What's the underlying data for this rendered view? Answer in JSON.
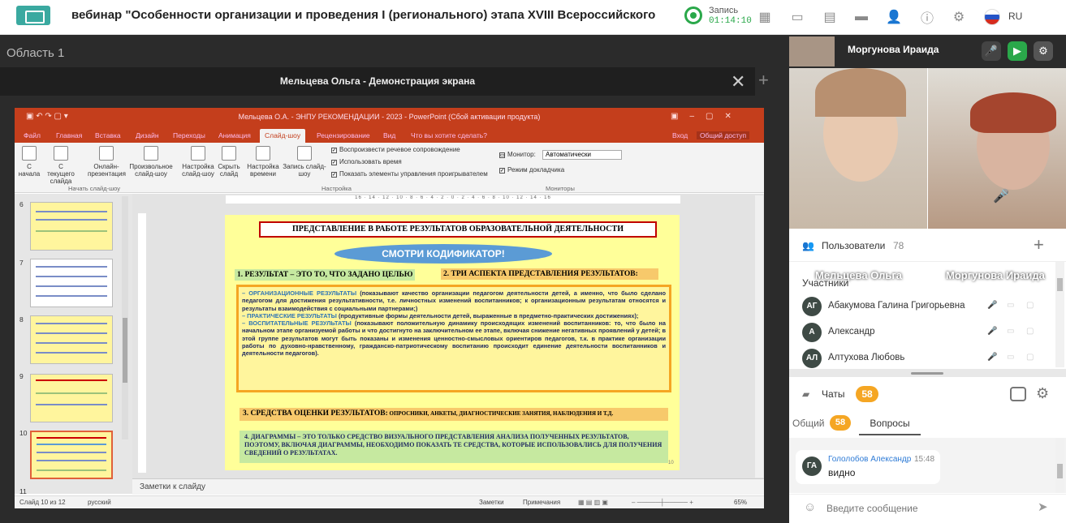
{
  "header": {
    "title": "вебинар \"Особенности организации и проведения I (регионального) этапа XVIII Всероссийского конкурса в...",
    "recording_label": "Запись",
    "recording_time": "01:14:10",
    "language": "RU"
  },
  "area": {
    "label": "Область 1"
  },
  "screen_share": {
    "title": "Мельцева Ольга - Демонстрация экрана"
  },
  "ppt": {
    "doc_title": "Мельцева О.А. - ЭНПУ РЕКОМЕНДАЦИИ - 2023 - PowerPoint (Сбой активации продукта)",
    "tabs": [
      "Файл",
      "Главная",
      "Вставка",
      "Дизайн",
      "Переходы",
      "Анимация",
      "Слайд-шоу",
      "Рецензирование",
      "Вид",
      "Что вы хотите сделать?"
    ],
    "right_tabs": [
      "Вход",
      "Общий доступ"
    ],
    "ribbon": {
      "b1": "С начала",
      "b2": "С текущего слайда",
      "b3": "Онлайн-презентация",
      "b4": "Произвольное слайд-шоу",
      "b5": "Настройка слайд-шоу",
      "b6": "Скрыть слайд",
      "b7": "Настройка времени",
      "b8": "Запись слайд-шоу",
      "c1": "Воспроизвести речевое сопровождение",
      "c2": "Использовать время",
      "c3": "Показать элементы управления проигрывателем",
      "monitor_label": "Монитор:",
      "monitor_value": "Автоматически",
      "c4": "Режим докладчика",
      "g1": "Начать слайд-шоу",
      "g2": "Настройка",
      "g3": "Мониторы"
    },
    "thumb_numbers": [
      "6",
      "7",
      "8",
      "9",
      "10",
      "11"
    ],
    "ruler": "16 · 14 · 12 · 10 · 8 · 6 · 4 · 2 · 0 · 2 · 4 · 6 · 8 · 10 · 12 · 14 · 16",
    "notes": "Заметки к слайду",
    "status": {
      "slide": "Слайд 10 из 12",
      "lang": "русский",
      "notes": "Заметки",
      "comments": "Примечания",
      "zoom": "65%"
    }
  },
  "slide": {
    "title": "ПРЕДСТАВЛЕНИЕ В РАБОТЕ РЕЗУЛЬТАТОВ ОБРАЗОВАТЕЛЬНОЙ ДЕЯТЕЛЬНОСТИ",
    "badge": "СМОТРИ КОДИФИКАТОР!",
    "h1": "1. РЕЗУЛЬТАТ – ЭТО ТО, ЧТО ЗАДАНО ЦЕЛЬЮ",
    "h2": "2. ТРИ АСПЕКТА ПРЕДСТАВЛЕНИЯ РЕЗУЛЬТАТОВ:",
    "p1k": "– ОРГАНИЗАЦИОННЫЕ РЕЗУЛЬТАТЫ",
    "p1": " (показывают качество организации педагогом деятельности детей, а именно, что было сделано педагогом для достижения результативности, т.е. личностных изменений воспитанников; к организационным результатам относятся и результаты взаимодействия с социальными партнерами;)",
    "p2k": "– ПРАКТИЧЕСКИЕ РЕЗУЛЬТАТЫ",
    "p2": " (продуктивные формы деятельности детей, выраженные в предметно-практических достижениях);",
    "p3k": "– ВОСПИТАТЕЛЬНЫЕ РЕЗУЛЬТАТЫ",
    "p3": " (показывают положительную динамику происходящих изменений воспитанников: то, что было на начальном этапе организуемой работы и что достигнуто на заключительном ее этапе, включая снижение негативных проявлений у детей; в этой группе результатов могут быть показаны и изменения ценностно-смысловых ориентиров педагогов, т.к. в практике организации работы по духовно-нравственному, гражданско-патриотическому воспитанию происходит единение деятельности воспитанников и деятельности педагогов).",
    "h3": "3. СРЕДСТВА ОЦЕНКИ РЕЗУЛЬТАТОВ:",
    "h3s": " ОПРОСНИКИ, АНКЕТЫ, ДИАГНОСТИЧЕСКИЕ ЗАНЯТИЯ, НАБЛЮДЕНИЯ И Т.Д.",
    "diag": "4. ДИАГРАММЫ – ЭТО ТОЛЬКО СРЕДСТВО ВИЗУАЛЬНОГО ПРЕДСТАВЛЕНИЯ АНАЛИЗА ПОЛУЧЕННЫХ РЕЗУЛЬТАТОВ, ПОЭТОМУ, ВКЛЮЧАЯ ДИАГРАММЫ, НЕОБХОДИМО ПОКАЗАТЬ ТЕ СРЕДСТВА, КОТОРЫЕ ИСПОЛЬЗОВАЛИСЬ ДЛЯ ПОЛУЧЕНИЯ СВЕДЕНИЙ О РЕЗУЛЬТАТАХ.",
    "num": "10"
  },
  "video": {
    "top_name": "Моргунова Ираида",
    "name1": "Мельцева Ольга",
    "name2": "Моргунова Ираида"
  },
  "users": {
    "label": "Пользователи",
    "count": "78",
    "section": "Участники",
    "list": [
      {
        "initials": "АГ",
        "name": "Абакумова Галина Григорьевна"
      },
      {
        "initials": "А",
        "name": "Александр"
      },
      {
        "initials": "АЛ",
        "name": "Алтухова Любовь"
      }
    ]
  },
  "chats": {
    "label": "Чаты",
    "count": "58",
    "tab_all": "Общий",
    "tab_all_count": "58",
    "tab_questions": "Вопросы",
    "message": {
      "initials": "ГА",
      "author": "Гололобов Александр",
      "time": "15:48",
      "text": "видно"
    },
    "input_placeholder": "Введите сообщение"
  },
  "colors": {
    "accent": "#f5a623",
    "rec": "#2aa84a",
    "ppt": "#c43e1c"
  }
}
